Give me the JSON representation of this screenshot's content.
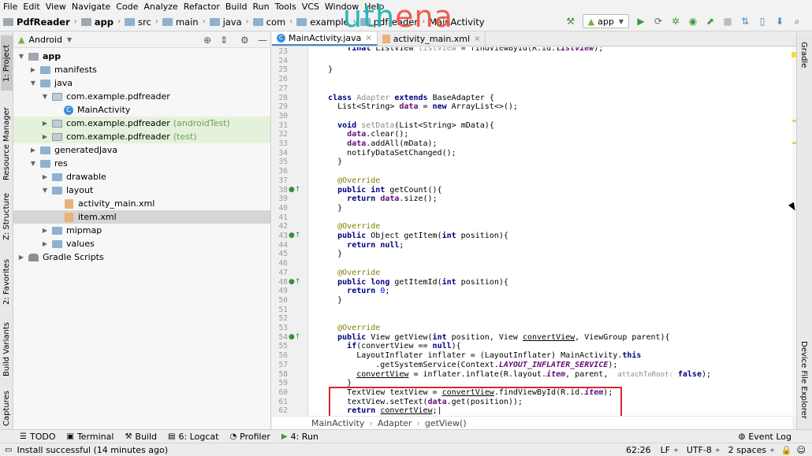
{
  "menu": [
    "File",
    "Edit",
    "View",
    "Navigate",
    "Code",
    "Analyze",
    "Refactor",
    "Build",
    "Run",
    "Tools",
    "VCS",
    "Window",
    "Help"
  ],
  "watermark": {
    "part1": "uth",
    "part2": "ena"
  },
  "breadcrumb": [
    "PdfReader",
    "app",
    "src",
    "main",
    "java",
    "com",
    "example",
    "pdfreader",
    "MainActivity"
  ],
  "run_config": "app",
  "left_tabs": [
    "1: Project",
    "Resource Manager",
    "Z: Structure",
    "2: Favorites",
    "Build Variants",
    "Captures"
  ],
  "right_tabs": [
    "Gradle",
    "Device File Explorer"
  ],
  "project_view": "Android",
  "tree": [
    {
      "label": "app",
      "hint": ""
    },
    {
      "label": "manifests",
      "hint": ""
    },
    {
      "label": "java",
      "hint": ""
    },
    {
      "label": "com.example.pdfreader",
      "hint": ""
    },
    {
      "label": "MainActivity",
      "hint": ""
    },
    {
      "label": "com.example.pdfreader",
      "hint": "(androidTest)"
    },
    {
      "label": "com.example.pdfreader",
      "hint": "(test)"
    },
    {
      "label": "generatedJava",
      "hint": ""
    },
    {
      "label": "res",
      "hint": ""
    },
    {
      "label": "drawable",
      "hint": ""
    },
    {
      "label": "layout",
      "hint": ""
    },
    {
      "label": "activity_main.xml",
      "hint": ""
    },
    {
      "label": "item.xml",
      "hint": ""
    },
    {
      "label": "mipmap",
      "hint": ""
    },
    {
      "label": "values",
      "hint": ""
    },
    {
      "label": "Gradle Scripts",
      "hint": ""
    }
  ],
  "tabs": [
    {
      "label": "MainActivity.java",
      "active": true
    },
    {
      "label": "activity_main.xml",
      "active": false
    }
  ],
  "line_numbers": [
    "23",
    "24",
    "25",
    "26",
    "27",
    "28",
    "29",
    "30",
    "31",
    "32",
    "33",
    "34",
    "35",
    "36",
    "37",
    "38",
    "39",
    "40",
    "41",
    "42",
    "43",
    "44",
    "45",
    "46",
    "47",
    "48",
    "49",
    "50",
    "51",
    "52",
    "53",
    "54",
    "55",
    "56",
    "57",
    "58",
    "59",
    "60",
    "61",
    "62"
  ],
  "editor_crumbs": [
    "MainActivity",
    "Adapter",
    "getView()"
  ],
  "bottom_tools": [
    "TODO",
    "Terminal",
    "Build",
    "6: Logcat",
    "Profiler",
    "4: Run"
  ],
  "event_log": "Event Log",
  "status": {
    "message": "Install successful (14 minutes ago)",
    "position": "62:26",
    "line_sep": "LF",
    "encoding": "UTF-8",
    "indent": "2 spaces"
  }
}
